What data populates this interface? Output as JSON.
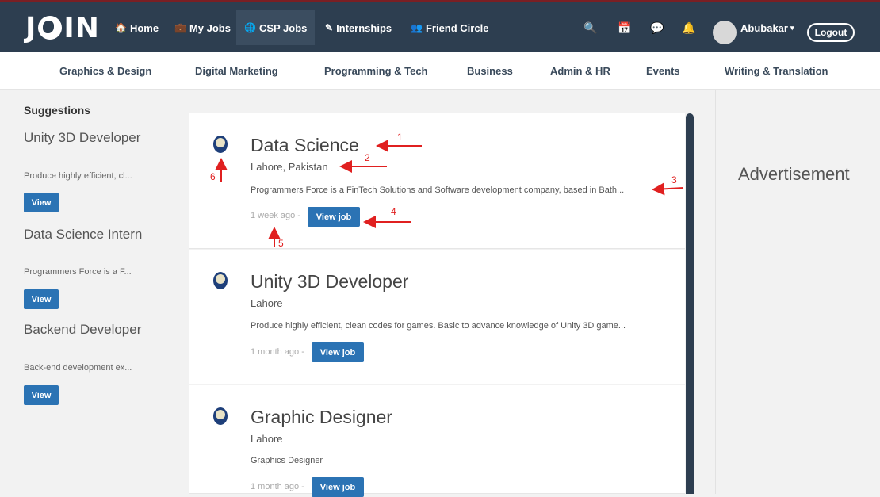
{
  "brand": {
    "logo_left": "J",
    "logo_right": "IN"
  },
  "nav": {
    "home": "Home",
    "my_jobs": "My Jobs",
    "csp_jobs": "CSP Jobs",
    "internships": "Internships",
    "friend_circle": "Friend Circle",
    "user": "Abubakar",
    "logout": "Logout"
  },
  "categories": [
    "Graphics & Design",
    "Digital Marketing",
    "Programming & Tech",
    "Business",
    "Admin & HR",
    "Events",
    "Writing & Translation"
  ],
  "sidebar": {
    "title": "Suggestions",
    "items": [
      {
        "name": "Unity 3D Developer",
        "desc": "Produce highly efficient, cl...",
        "button": "View"
      },
      {
        "name": "Data Science Intern",
        "desc": "Programmers Force is a F...",
        "button": "View"
      },
      {
        "name": "Backend Developer",
        "desc": "Back-end development ex...",
        "button": "View"
      }
    ]
  },
  "jobs": [
    {
      "title": "Data Science",
      "location": "Lahore, Pakistan",
      "description": "Programmers Force is a FinTech Solutions and Software development company, based in Bath...",
      "time": "1 week ago -",
      "button": "View job"
    },
    {
      "title": "Unity 3D Developer",
      "location": "Lahore",
      "description": "Produce highly efficient, clean codes for games. Basic to advance knowledge of Unity 3D game...",
      "time": "1 month ago -",
      "button": "View job"
    },
    {
      "title": "Graphic Designer",
      "location": "Lahore",
      "description": "Graphics Designer",
      "time": "1 month ago -",
      "button": "View job"
    }
  ],
  "advertisement": "Advertisement",
  "annotations": [
    "1",
    "2",
    "3",
    "4",
    "5",
    "6"
  ],
  "colors": {
    "navbar": "#2d3e50",
    "button": "#2b73b4",
    "annotation": "#e02020"
  }
}
